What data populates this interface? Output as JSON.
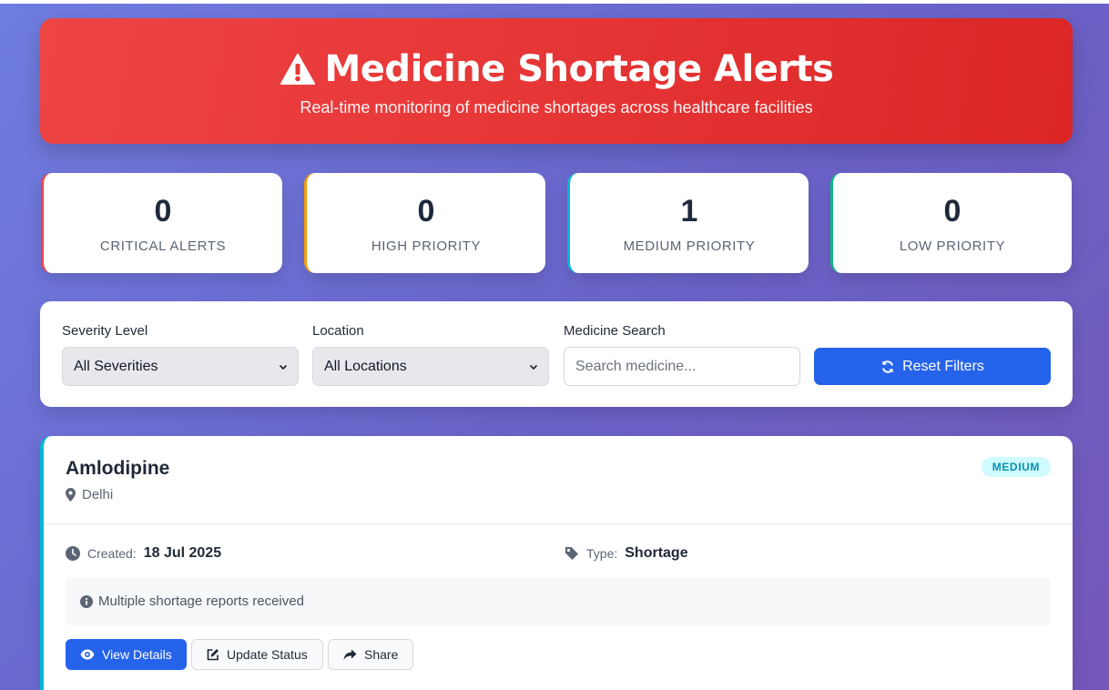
{
  "header": {
    "title": "Medicine Shortage Alerts",
    "subtitle": "Real-time monitoring of medicine shortages across healthcare facilities",
    "icon": "warning-icon"
  },
  "stats": [
    {
      "value": "0",
      "label": "CRITICAL ALERTS",
      "color": "#ef4444"
    },
    {
      "value": "0",
      "label": "HIGH PRIORITY",
      "color": "#f59e0b"
    },
    {
      "value": "1",
      "label": "MEDIUM PRIORITY",
      "color": "#06b6d4"
    },
    {
      "value": "0",
      "label": "LOW PRIORITY",
      "color": "#10b981"
    }
  ],
  "filters": {
    "severity_label": "Severity Level",
    "severity_value": "All Severities",
    "location_label": "Location",
    "location_value": "All Locations",
    "search_label": "Medicine Search",
    "search_placeholder": "Search medicine...",
    "reset_label": "Reset Filters"
  },
  "alerts": [
    {
      "medicine": "Amlodipine",
      "location": "Delhi",
      "severity": "MEDIUM",
      "created_label": "Created:",
      "created": "18 Jul 2025",
      "type_label": "Type:",
      "type": "Shortage",
      "note": "Multiple shortage reports received",
      "actions": {
        "view": "View Details",
        "update": "Update Status",
        "share": "Share"
      }
    }
  ],
  "colors": {
    "primary": "#2563eb",
    "header": "#dc2626",
    "medium": "#06b6d4"
  }
}
